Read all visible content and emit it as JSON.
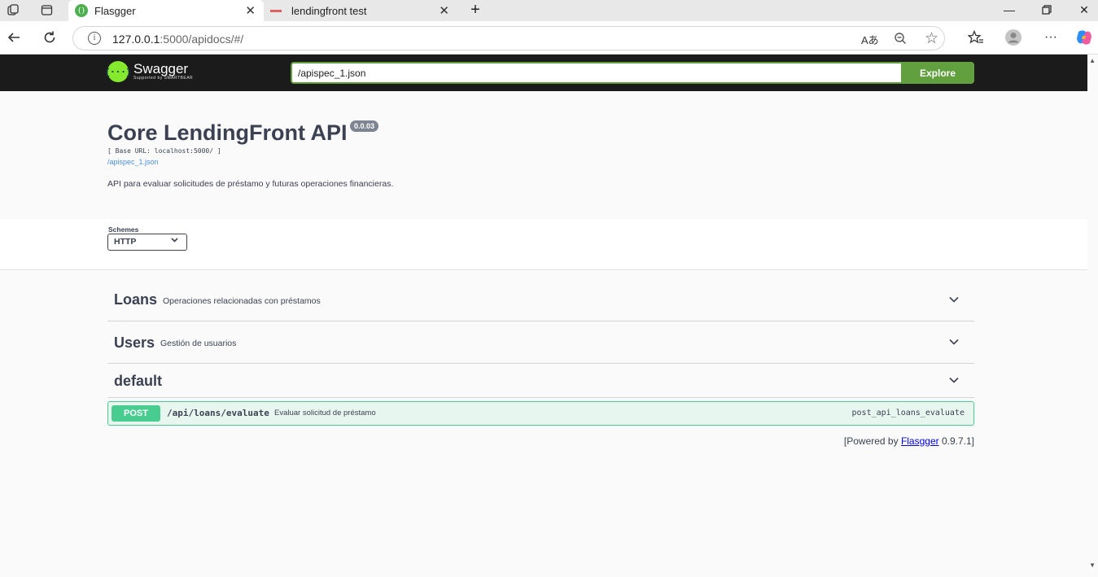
{
  "browser": {
    "tabs": [
      {
        "title": "Flasgger",
        "active": true
      },
      {
        "title": "lendingfront test",
        "active": false
      }
    ],
    "url_host": "127.0.0.1",
    "url_rest": ":5000/apidocs/#/",
    "colors": {
      "favicon": "#4caf50"
    }
  },
  "swagger": {
    "logo_text": "Swagger",
    "logo_sub": "Supported by SMARTBEAR",
    "spec_url": "/apispec_1.json",
    "explore_label": "Explore"
  },
  "info": {
    "title": "Core LendingFront API",
    "version": "0.0.03",
    "base_url": "[ Base URL: localhost:5000/ ]",
    "spec_link": "/apispec_1.json",
    "description": "API para evaluar solicitudes de préstamo y futuras operaciones financieras."
  },
  "schemes": {
    "label": "Schemes",
    "selected": "HTTP"
  },
  "tags": [
    {
      "name": "Loans",
      "description": "Operaciones relacionadas con préstamos"
    },
    {
      "name": "Users",
      "description": "Gestión de usuarios"
    },
    {
      "name": "default",
      "description": ""
    }
  ],
  "operation": {
    "method": "POST",
    "path": "/api/loans/evaluate",
    "summary": "Evaluar solicitud de préstamo",
    "operation_id": "post_api_loans_evaluate"
  },
  "footer": {
    "prefix": "[Powered by ",
    "link": "Flasgger",
    "suffix": " 0.9.7.1]"
  }
}
